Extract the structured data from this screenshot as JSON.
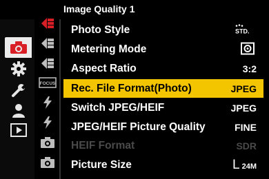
{
  "screen_title": "Image Quality 1",
  "categories": [
    {
      "icon": "camera-icon",
      "active": true,
      "accent": "#d91f26"
    },
    {
      "icon": "gear-icon",
      "active": false
    },
    {
      "icon": "wrench-icon",
      "active": false
    },
    {
      "icon": "person-icon",
      "active": false
    },
    {
      "icon": "playback-icon",
      "active": false
    }
  ],
  "subtabs": [
    {
      "icon": "arrow-tab-icon",
      "active": true,
      "accent": "#d91f26"
    },
    {
      "icon": "arrow-tab-icon",
      "active": false
    },
    {
      "icon": "arrow-tab-icon",
      "active": false
    },
    {
      "icon": "focus-tab-icon",
      "label": "FOCUS",
      "active": false
    },
    {
      "icon": "flash-tab-icon",
      "active": false
    },
    {
      "icon": "flash-tab-icon",
      "active": false
    },
    {
      "icon": "camera-tab-icon",
      "active": false
    },
    {
      "icon": "camera-tab-icon",
      "active": false
    }
  ],
  "menu": [
    {
      "label": "Photo Style",
      "value": "",
      "value_icon": "photo-style-standard-icon",
      "value_icon_text": "STD.",
      "state": "normal"
    },
    {
      "label": "Metering Mode",
      "value": "",
      "value_icon": "metering-multiple-icon",
      "state": "normal"
    },
    {
      "label": "Aspect Ratio",
      "value": "3:2",
      "state": "normal"
    },
    {
      "label": "Rec. File Format(Photo)",
      "value": "JPEG",
      "state": "selected"
    },
    {
      "label": "Switch JPEG/HEIF",
      "value": "JPEG",
      "state": "normal"
    },
    {
      "label": "JPEG/HEIF Picture Quality",
      "value": "FINE",
      "state": "normal"
    },
    {
      "label": "HEIF Format",
      "value": "SDR",
      "state": "disabled"
    },
    {
      "label": "Picture Size",
      "value": "",
      "value_icon": "picture-size-icon",
      "value_icon_text_large": "L",
      "value_icon_text_small": "24M",
      "state": "normal"
    }
  ],
  "colors": {
    "highlight": "#f3c400",
    "accent_red": "#d91f26",
    "disabled_text": "#4a4a4a"
  }
}
